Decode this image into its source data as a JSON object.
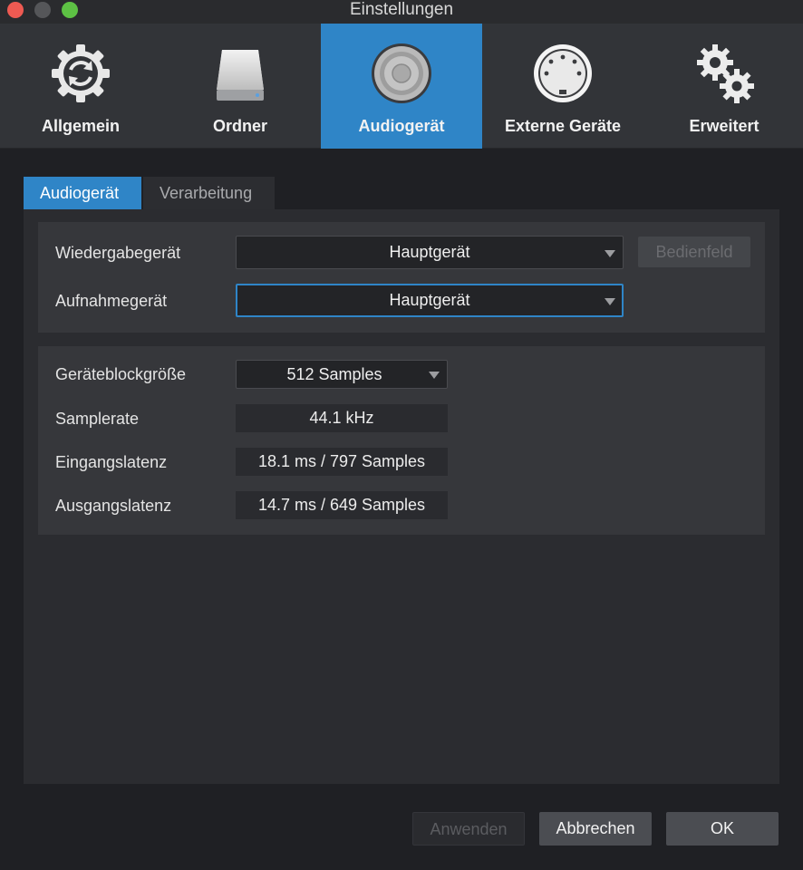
{
  "window": {
    "title": "Einstellungen"
  },
  "toolbar": {
    "items": [
      {
        "label": "Allgemein",
        "icon": "sync-gear-icon",
        "active": false
      },
      {
        "label": "Ordner",
        "icon": "drive-icon",
        "active": false
      },
      {
        "label": "Audiogerät",
        "icon": "speaker-icon",
        "active": true
      },
      {
        "label": "Externe Geräte",
        "icon": "midi-connector-icon",
        "active": false
      },
      {
        "label": "Erweitert",
        "icon": "gears-icon",
        "active": false
      }
    ]
  },
  "tabs": [
    {
      "label": "Audiogerät",
      "active": true
    },
    {
      "label": "Verarbeitung",
      "active": false
    }
  ],
  "devices": {
    "playback_label": "Wiedergabegerät",
    "playback_value": "Hauptgerät",
    "control_panel_label": "Bedienfeld",
    "record_label": "Aufnahmegerät",
    "record_value": "Hauptgerät"
  },
  "settings": {
    "blocksize_label": "Geräteblockgröße",
    "blocksize_value": "512 Samples",
    "samplerate_label": "Samplerate",
    "samplerate_value": "44.1 kHz",
    "input_latency_label": "Eingangslatenz",
    "input_latency_value": "18.1 ms / 797 Samples",
    "output_latency_label": "Ausgangslatenz",
    "output_latency_value": "14.7 ms / 649 Samples"
  },
  "footer": {
    "apply_label": "Anwenden",
    "cancel_label": "Abbrechen",
    "ok_label": "OK"
  },
  "colors": {
    "accent": "#2f85c7",
    "background": "#1f2024",
    "toolbar": "#323438",
    "close": "#ee5a52",
    "zoom": "#5dc144"
  }
}
